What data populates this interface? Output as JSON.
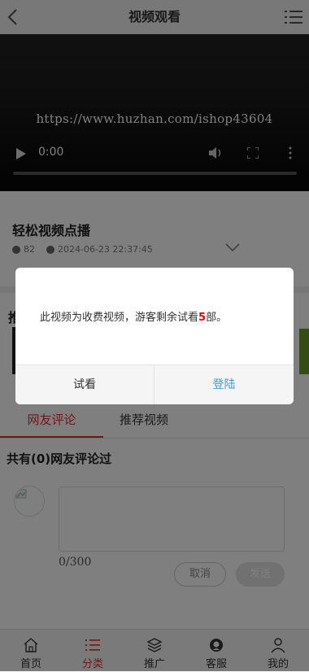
{
  "header": {
    "title": "视频观看"
  },
  "video": {
    "watermark": "https://www.huzhan.com/ishop43604",
    "time": "0:00"
  },
  "info": {
    "title": "轻松视频点播",
    "views": "82",
    "date": "2024-06-23 22:37:45"
  },
  "section": {
    "label": "推"
  },
  "tabs": [
    {
      "label": "网友评论"
    },
    {
      "label": "推荐视频"
    }
  ],
  "comments": {
    "heading": "共有(0)网友评论过",
    "counter": "0/300",
    "cancel_label": "取消",
    "send_label": "发送"
  },
  "nav": [
    {
      "label": "首页",
      "icon": "home-icon"
    },
    {
      "label": "分类",
      "icon": "list-icon",
      "active": true
    },
    {
      "label": "推广",
      "icon": "layers-icon"
    },
    {
      "label": "客服",
      "icon": "support-icon"
    },
    {
      "label": "我的",
      "icon": "user-icon"
    }
  ],
  "dialog": {
    "msg_prefix": "此视频为收费视频，游客剩余试看",
    "count": "5",
    "msg_suffix": "部。",
    "trial_label": "试看",
    "login_label": "登陆"
  },
  "colors": {
    "accent": "#dd3333",
    "link": "#3a9ae0"
  }
}
